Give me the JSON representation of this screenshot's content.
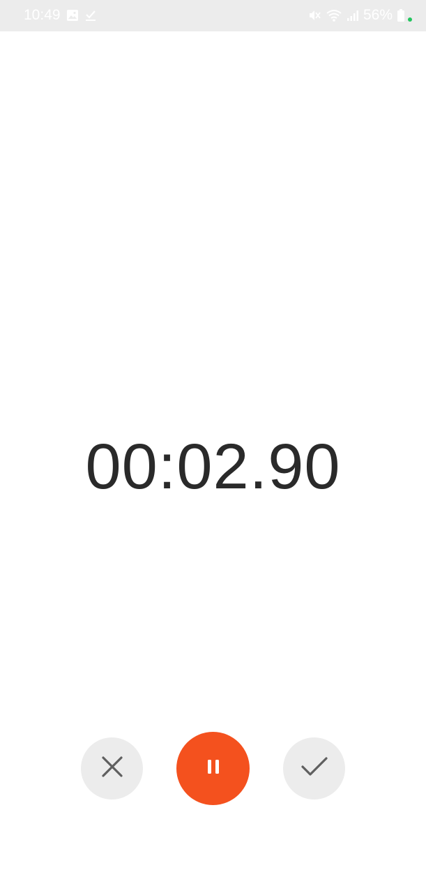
{
  "status_bar": {
    "time": "10:49",
    "battery_percent": "56%",
    "icons": [
      "image-icon",
      "download-done-icon",
      "mute-icon",
      "wifi-icon",
      "signal-icon",
      "battery-icon"
    ],
    "charging_dot_color": "#22c55e"
  },
  "timer": {
    "display": "00:02.90"
  },
  "controls": {
    "cancel_icon": "close-icon",
    "pause_icon": "pause-icon",
    "done_icon": "check-icon",
    "accent_color": "#f4511e"
  }
}
